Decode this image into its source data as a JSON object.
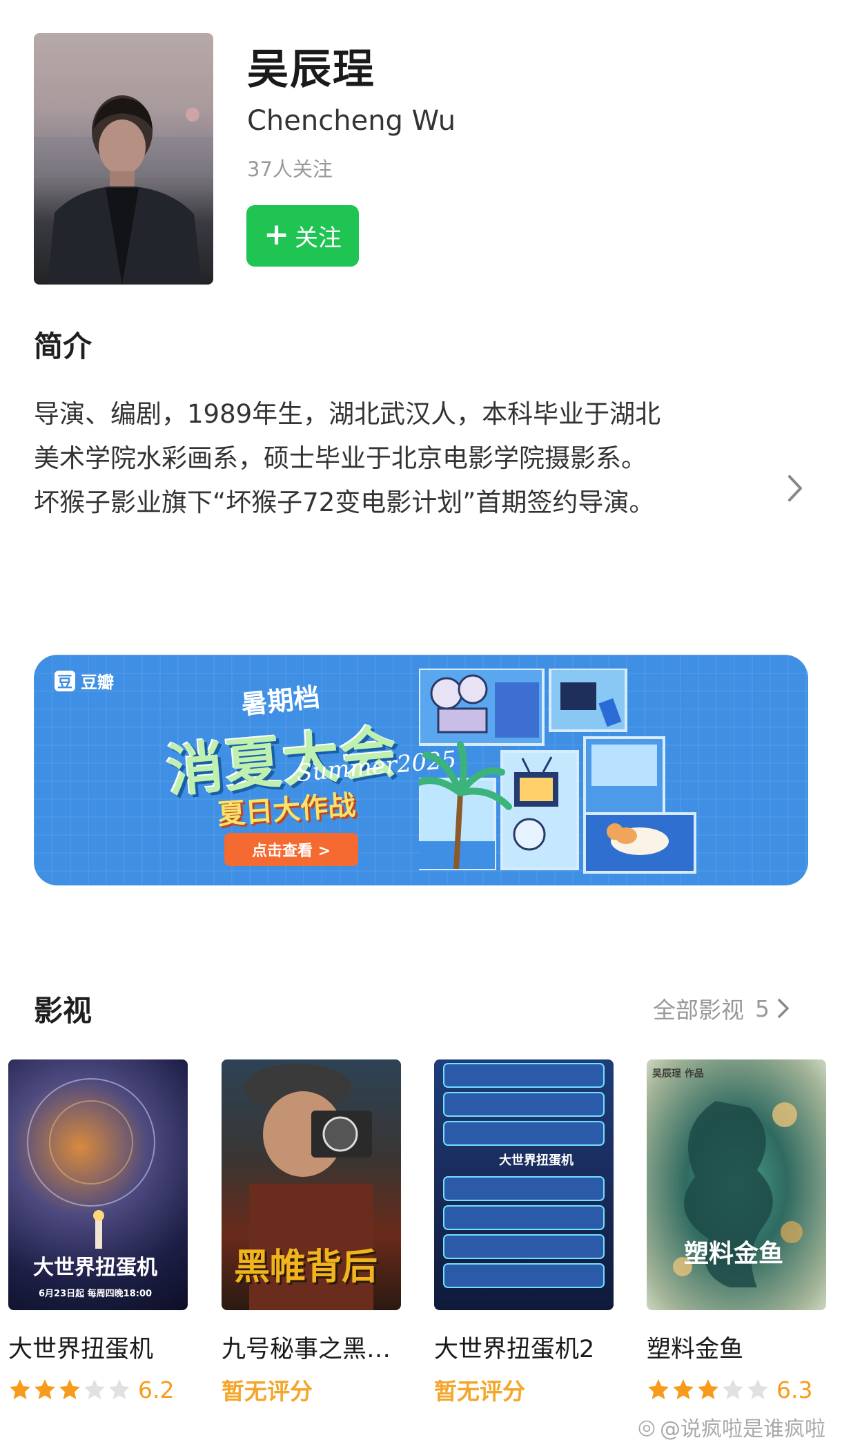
{
  "profile": {
    "name": "吴辰珵",
    "name_en": "Chencheng Wu",
    "followers": "37人关注",
    "follow_label": "关注"
  },
  "intro": {
    "title": "简介",
    "lines": [
      "导演、编剧，1989年生，湖北武汉人，本科毕业于湖北",
      "美术学院水彩画系，硕士毕业于北京电影学院摄影系。",
      "坏猴子影业旗下“坏猴子72变电影计划”首期签约导演。"
    ]
  },
  "banner": {
    "logo_text": "豆瓣",
    "season": "暑期档",
    "title": "消夏大会",
    "summer": "Summer2025",
    "subtitle": "夏日大作战",
    "cta": "点击查看 >"
  },
  "films": {
    "title": "影视",
    "all_label": "全部影视",
    "all_count": "5",
    "items": [
      {
        "title": "大世界扭蛋机",
        "rating": 6.2,
        "stars": 3,
        "score_text": "6.2",
        "poster_caption": "大世界扭蛋机",
        "poster_sub": "6月23日起 每周四晚18:00"
      },
      {
        "title": "九号秘事之黑…",
        "rating": null,
        "stars": 0,
        "score_text": "暂无评分",
        "poster_caption": "黑帷背后"
      },
      {
        "title": "大世界扭蛋机2",
        "rating": null,
        "stars": 0,
        "score_text": "暂无评分",
        "poster_caption": "大世界扭蛋机"
      },
      {
        "title": "塑料金鱼",
        "rating": 6.3,
        "stars": 3,
        "score_text": "6.3",
        "poster_caption": "塑料金鱼",
        "poster_sub": "吴辰珵 作品"
      }
    ]
  },
  "watermark": "@说疯啦是谁疯啦",
  "colors": {
    "follow_green": "#1fc453",
    "rating_orange": "#f79b1c",
    "banner_blue": "#3f8fe4"
  }
}
